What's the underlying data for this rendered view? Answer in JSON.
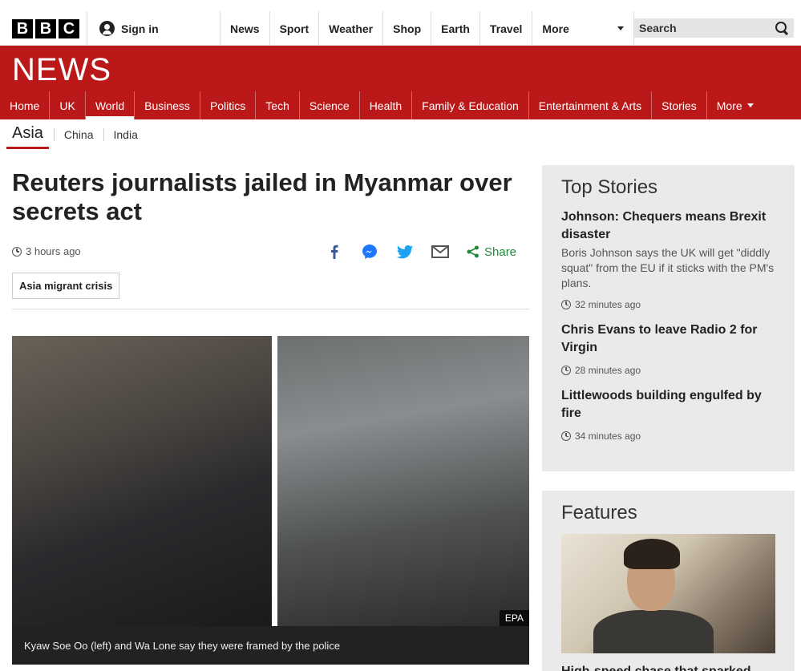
{
  "topbar": {
    "logo_letters": [
      "B",
      "B",
      "C"
    ],
    "signin_label": "Sign in",
    "nav": [
      "News",
      "Sport",
      "Weather",
      "Shop",
      "Earth",
      "Travel"
    ],
    "more_label": "More",
    "search_placeholder": "Search"
  },
  "banner": {
    "title": "NEWS",
    "nav": [
      "Home",
      "UK",
      "World",
      "Business",
      "Politics",
      "Tech",
      "Science",
      "Health",
      "Family & Education",
      "Entertainment & Arts",
      "Stories"
    ],
    "active": "World",
    "more_label": "More",
    "color": "#bb1919"
  },
  "subnav": {
    "active": "Asia",
    "items": [
      "China",
      "India"
    ]
  },
  "article": {
    "headline": "Reuters journalists jailed in Myanmar over secrets act",
    "timestamp": "3 hours ago",
    "share_label": "Share",
    "tag": "Asia migrant crisis",
    "image_credit": "EPA",
    "caption": "Kyaw Soe Oo (left) and Wa Lone say they were framed by the police"
  },
  "top_stories": {
    "title": "Top Stories",
    "stories": [
      {
        "title": "Johnson: Chequers means Brexit disaster",
        "summary": "Boris Johnson says the UK will get \"diddly squat\" from the EU if it sticks with the PM's plans.",
        "time": "32 minutes ago"
      },
      {
        "title": "Chris Evans to leave Radio 2 for Virgin",
        "summary": "",
        "time": "28 minutes ago"
      },
      {
        "title": "Littlewoods building engulfed by fire",
        "summary": "",
        "time": "34 minutes ago"
      }
    ]
  },
  "features": {
    "title": "Features",
    "first_title": "High-speed chase that sparked"
  }
}
